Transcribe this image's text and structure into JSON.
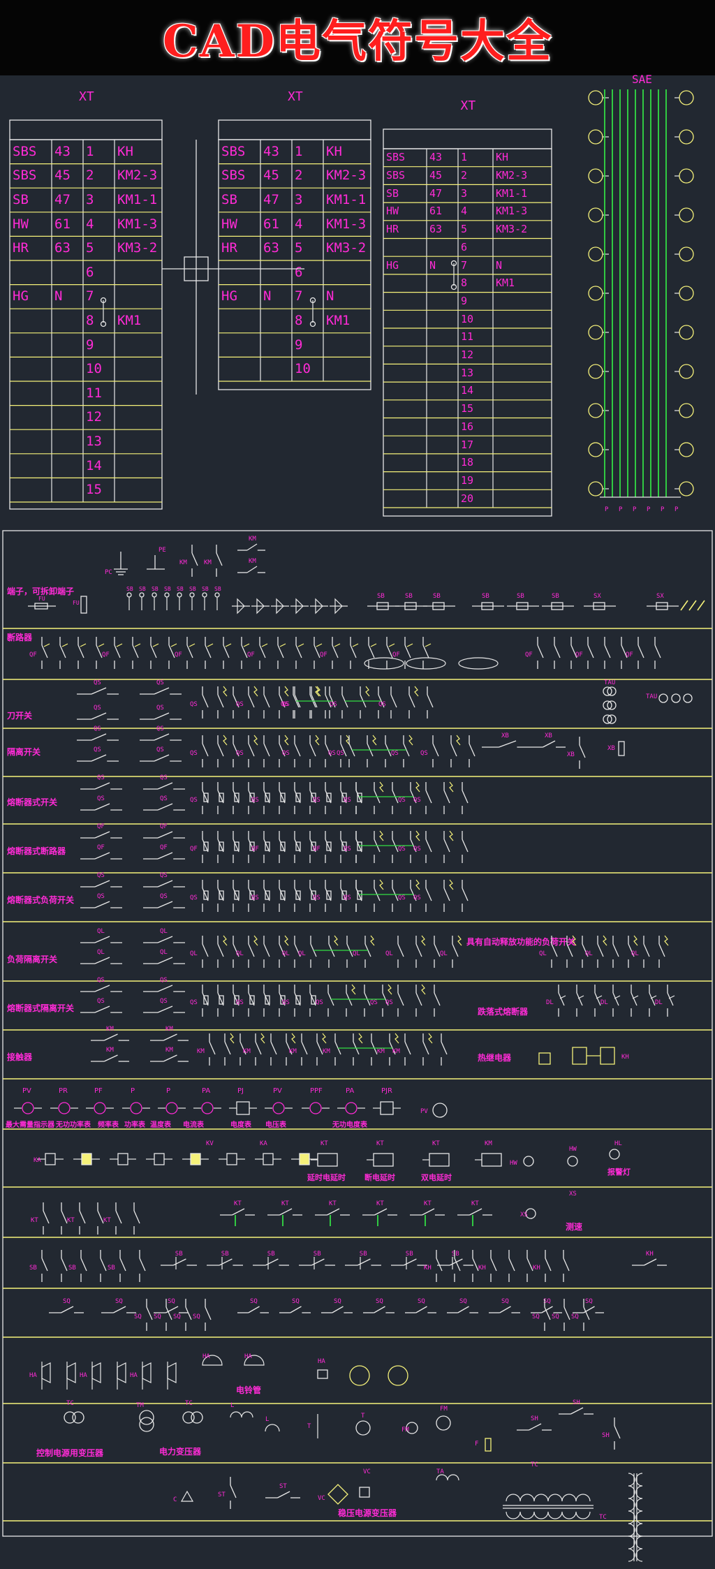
{
  "banner": {
    "title": "CAD电气符号大全"
  },
  "tables": [
    {
      "title": "XT",
      "rows": [
        [
          "SBS",
          "43",
          "1",
          "KH"
        ],
        [
          "SBS",
          "45",
          "2",
          "KM2-3"
        ],
        [
          "SB",
          "47",
          "3",
          "KM1-1"
        ],
        [
          "HW",
          "61",
          "4",
          "KM1-3"
        ],
        [
          "HR",
          "63",
          "5",
          "KM3-2"
        ],
        [
          "",
          "",
          "6",
          ""
        ],
        [
          "HG",
          "N",
          "7",
          ""
        ],
        [
          "",
          "",
          "8",
          "KM1"
        ],
        [
          "",
          "",
          "9",
          ""
        ],
        [
          "",
          "",
          "10",
          ""
        ],
        [
          "",
          "",
          "11",
          ""
        ],
        [
          "",
          "",
          "12",
          ""
        ],
        [
          "",
          "",
          "13",
          ""
        ],
        [
          "",
          "",
          "14",
          ""
        ],
        [
          "",
          "",
          "15",
          ""
        ]
      ]
    },
    {
      "title": "XT",
      "rows": [
        [
          "SBS",
          "43",
          "1",
          "KH"
        ],
        [
          "SBS",
          "45",
          "2",
          "KM2-3"
        ],
        [
          "SB",
          "47",
          "3",
          "KM1-1"
        ],
        [
          "HW",
          "61",
          "4",
          "KM1-3"
        ],
        [
          "HR",
          "63",
          "5",
          "KM3-2"
        ],
        [
          "",
          "",
          "6",
          ""
        ],
        [
          "HG",
          "N",
          "7",
          "N"
        ],
        [
          "",
          "",
          "8",
          "KM1"
        ],
        [
          "",
          "",
          "9",
          ""
        ],
        [
          "",
          "",
          "10",
          ""
        ]
      ]
    },
    {
      "title": "XT",
      "rows": [
        [
          "SBS",
          "43",
          "1",
          "KH"
        ],
        [
          "SBS",
          "45",
          "2",
          "KM2-3"
        ],
        [
          "SB",
          "47",
          "3",
          "KM1-1"
        ],
        [
          "HW",
          "61",
          "4",
          "KM1-3"
        ],
        [
          "HR",
          "63",
          "5",
          "KM3-2"
        ],
        [
          "",
          "",
          "6",
          ""
        ],
        [
          "HG",
          "N",
          "7",
          "N"
        ],
        [
          "",
          "",
          "8",
          "KM1"
        ],
        [
          "",
          "",
          "9",
          ""
        ],
        [
          "",
          "",
          "10",
          ""
        ],
        [
          "",
          "",
          "11",
          ""
        ],
        [
          "",
          "",
          "12",
          ""
        ],
        [
          "",
          "",
          "13",
          ""
        ],
        [
          "",
          "",
          "14",
          ""
        ],
        [
          "",
          "",
          "15",
          ""
        ],
        [
          "",
          "",
          "16",
          ""
        ],
        [
          "",
          "",
          "17",
          ""
        ],
        [
          "",
          "",
          "18",
          ""
        ],
        [
          "",
          "",
          "19",
          ""
        ],
        [
          "",
          "",
          "20",
          ""
        ]
      ]
    }
  ],
  "terminal_strip": {
    "title": "SAE"
  },
  "categories": [
    "端子，可拆卸端子",
    "断路器",
    "刀开关",
    "隔离开关",
    "熔断器式开关",
    "熔断器式断路器",
    "熔断器式负荷开关",
    "负荷隔离开关",
    "熔断器式隔离开关",
    "接触器"
  ],
  "row_notes": {
    "load_switch_auto": "具有自动释放功能的负荷开关",
    "contactor_coil": "热继电器",
    "fuse_type": "跌落式熔断器"
  },
  "meters": {
    "codes": [
      "PV",
      "PR",
      "PF",
      "P",
      "P",
      "PA",
      "PJ",
      "PV",
      "PPF",
      "PA",
      "PJR"
    ],
    "captions": [
      "最大需量指示器",
      "无功功率表",
      "频率表",
      "功率表",
      "温度表",
      "电流表",
      "电度表",
      "电压表",
      "",
      "无功电度表"
    ]
  },
  "relay_row_notes": [
    "延时电延时",
    "断电延时",
    "双电延时",
    "报警灯"
  ],
  "timer_row_note": "测速",
  "bottom_notes": [
    "电铃管",
    "控制电源用变压器",
    "电力变压器",
    "稳压电源变压器"
  ],
  "tag_labels": {
    "qs": "QS",
    "qf": "QF",
    "ql": "QL",
    "km": "KM",
    "kt": "KT",
    "sb": "SB",
    "sq": "SQ",
    "ha": "HA",
    "tc": "TC",
    "tm": "TM",
    "kv": "KV",
    "ka": "KA",
    "hw": "HW",
    "hl": "HL",
    "xs": "XS",
    "sx": "SX",
    "fu": "FU",
    "xb": "XB",
    "tau": "TAU",
    "kh": "KH",
    "fm": "FM",
    "ta": "TA",
    "vc": "VC",
    "st": "ST",
    "l": "L",
    "t": "T",
    "sh": "SH",
    "pe": "PE",
    "pc": "PC"
  },
  "colors": {
    "magenta": "#ff2bd6",
    "yellow": "#f6f27a",
    "green": "#33dd44",
    "white": "#e8e8e8",
    "background": "#222831",
    "banner_red": "#ff1e1e"
  }
}
